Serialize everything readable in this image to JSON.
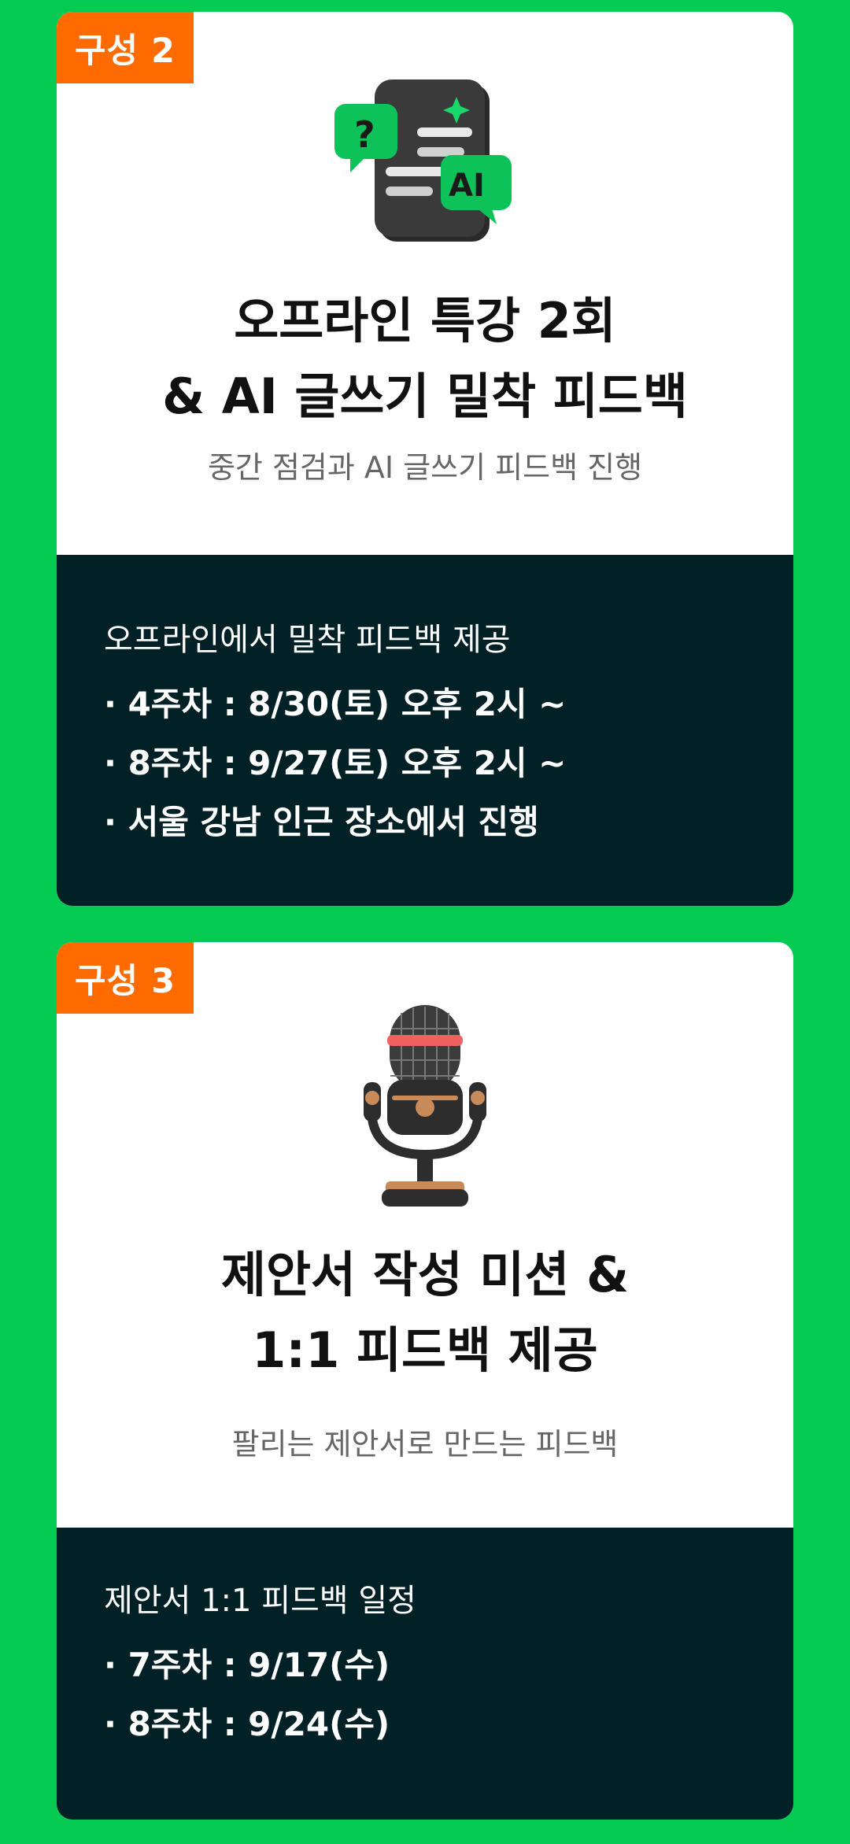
{
  "sections": [
    {
      "badge": "구성 2",
      "title_line1": "오프라인 특강 2회",
      "title_line2": "& AI 글쓰기 밀착 피드백",
      "subtitle": "중간 점검과 AI 글쓰기 피드백 진행",
      "illustration": "document-ai-chat-icon",
      "detail_heading": "오프라인에서 밀착 피드백 제공",
      "bullets": [
        "4주차 : 8/30(토) 오후 2시 ~",
        "8주차 : 9/27(토) 오후 2시 ~",
        "서울 강남 인근 장소에서 진행"
      ]
    },
    {
      "badge": "구성 3",
      "title_line1": "제안서 작성 미션 &",
      "title_line2": "1:1 피드백 제공",
      "subtitle": "팔리는 제안서로 만드는 피드백",
      "illustration": "microphone-icon",
      "detail_heading": "제안서 1:1 피드백 일정",
      "bullets": [
        "7주차 : 9/17(수)",
        "8주차 : 9/24(수)"
      ]
    }
  ],
  "colors": {
    "background": "#06cb52",
    "badge": "#ff6b00",
    "dark_panel": "#022126",
    "card": "#ffffff"
  }
}
